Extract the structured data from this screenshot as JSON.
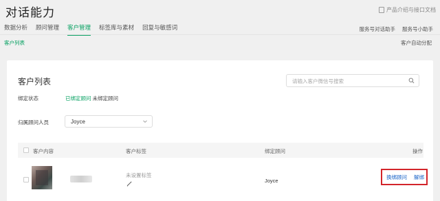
{
  "header": {
    "title": "对话能力",
    "docs_link": "产品介绍与接口文档",
    "tabs": [
      "数据分析",
      "顾问管理",
      "客户管理",
      "标签库与素材",
      "回复与敏感词"
    ],
    "active_tab_index": 2,
    "right_links": [
      "服务号对话助手",
      "服务号小助手"
    ]
  },
  "subnav": {
    "active": "客户列表",
    "right": "客户自动分配"
  },
  "customer_list": {
    "title": "客户列表",
    "search_placeholder": "请输入客户微信号搜索",
    "bind_status_label": "绑定状态",
    "bind_options": [
      "已绑定顾问",
      "未绑定顾问"
    ],
    "bind_selected_index": 0,
    "advisor_label": "归属顾问人员",
    "advisor_value": "Joyce",
    "columns": {
      "content": "客户内容",
      "tags": "客户标签",
      "advisor": "绑定顾问",
      "actions": "操作"
    },
    "rows": [
      {
        "tag": "未设置标签",
        "advisor": "Joyce",
        "action_change": "换绑顾问",
        "action_unbind": "解绑"
      }
    ]
  },
  "colors": {
    "accent": "#07a162",
    "link": "#1a64c8",
    "highlight_box": "#d3242a"
  },
  "icons": [
    "document-icon",
    "search-icon",
    "chevron-down-icon",
    "pencil-icon"
  ]
}
